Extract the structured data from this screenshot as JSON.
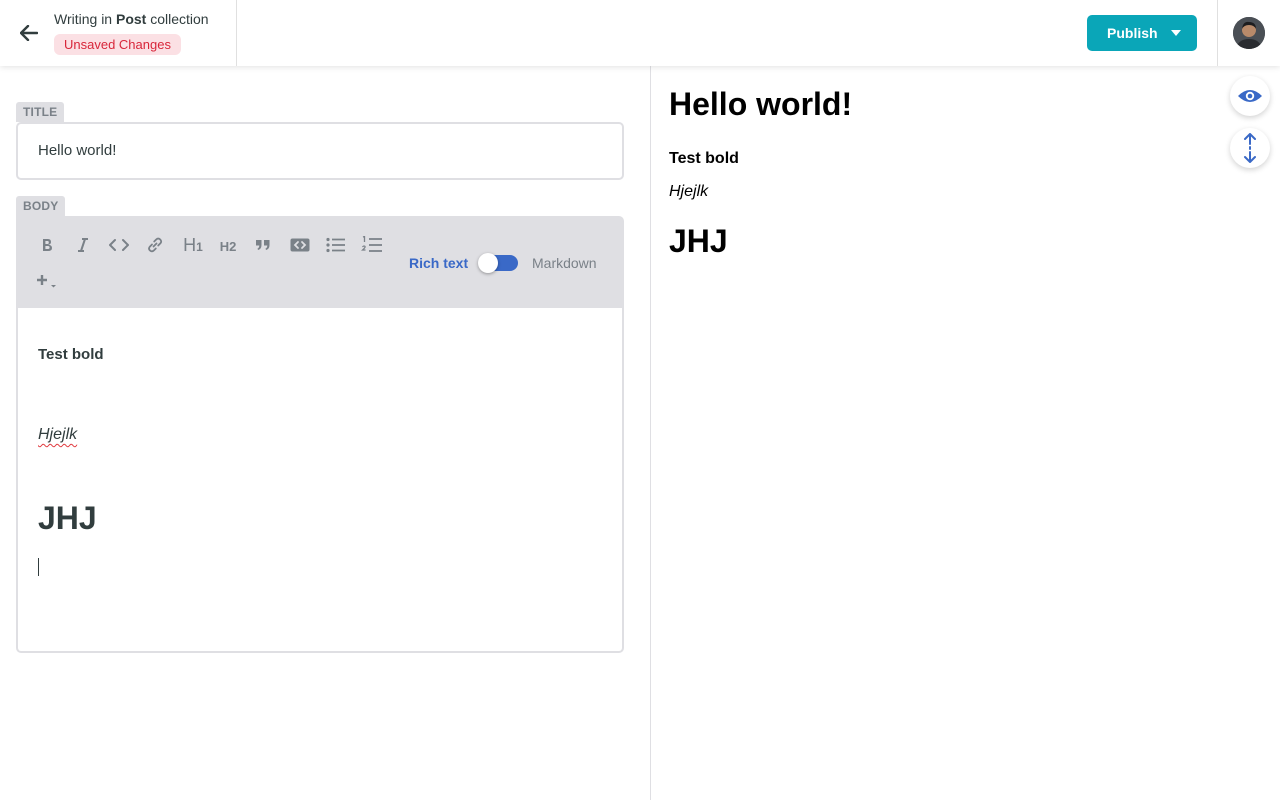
{
  "header": {
    "back_icon": "arrow-left-icon",
    "crumb_prefix": "Writing in",
    "collection_name": "Post",
    "crumb_suffix": "collection",
    "status_badge": "Unsaved Changes",
    "publish_label": "Publish",
    "publish_dropdown_icon": "caret-down-icon",
    "avatar_icon": "user-avatar"
  },
  "editor": {
    "title_label": "TITLE",
    "title_value": "Hello world!",
    "body_label": "BODY",
    "toolbar": {
      "buttons": [
        "bold-icon",
        "italic-icon",
        "code-icon",
        "link-icon",
        "heading-one-icon",
        "heading-two-icon",
        "quote-icon",
        "code-block-icon",
        "bulleted-list-icon",
        "numbered-list-icon",
        "add-component-icon"
      ],
      "h1_text": "H",
      "h1_sub": "1",
      "h2_text": "H",
      "h2_sub": "2",
      "mode_rich": "Rich text",
      "mode_markdown": "Markdown",
      "mode_selected": "Rich text"
    },
    "content": {
      "bold_line": "Test bold",
      "italic_line": "Hjejlk",
      "heading_line": "JHJ"
    }
  },
  "preview": {
    "title": "Hello world!",
    "bold_line": "Test bold",
    "italic_line": "Hjejlk",
    "heading_line": "JHJ",
    "toggle_preview_icon": "eye-icon",
    "sync_scroll_icon": "sync-scroll-icon"
  },
  "colors": {
    "accent": "#0aa6b8",
    "toggle_blue": "#3a69c7",
    "badge_bg": "#fbe0e4",
    "badge_text": "#d8263a"
  }
}
